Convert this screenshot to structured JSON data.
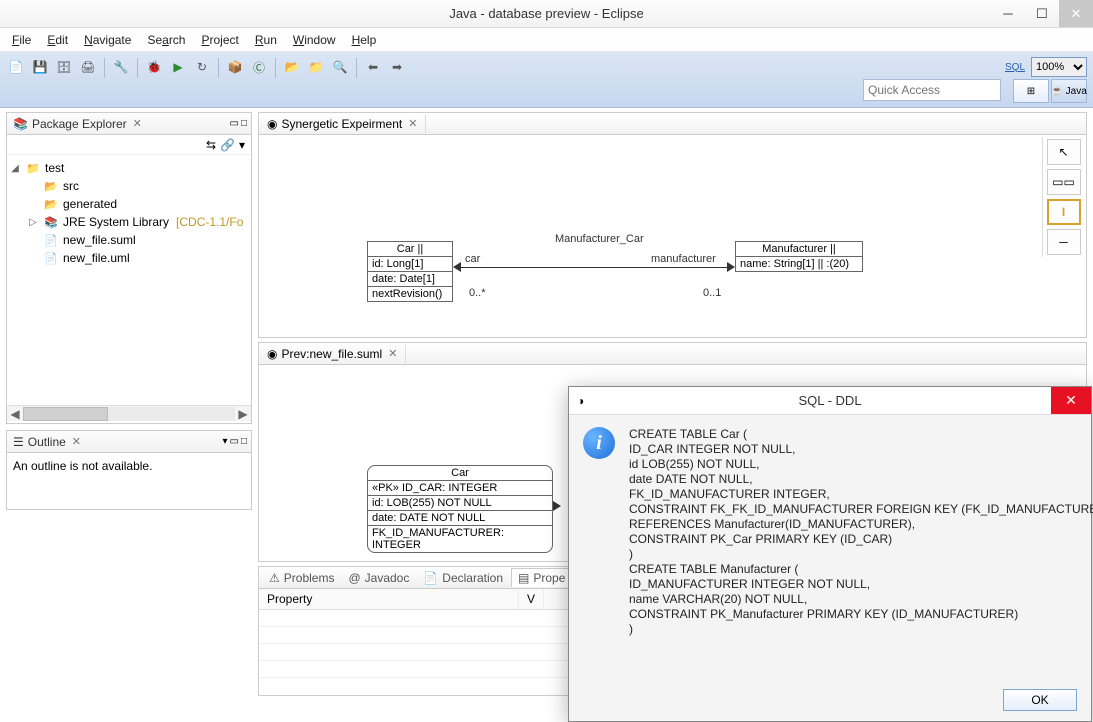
{
  "window": {
    "title": "Java - database preview - Eclipse"
  },
  "menu": {
    "file": "File",
    "edit": "Edit",
    "navigate": "Navigate",
    "search": "Search",
    "project": "Project",
    "run": "Run",
    "window": "Window",
    "help": "Help"
  },
  "toolbar": {
    "zoom": "100%",
    "quick_access_placeholder": "Quick Access",
    "perspective_java": "Java"
  },
  "package_explorer": {
    "title": "Package Explorer",
    "nodes": {
      "test": "test",
      "src": "src",
      "generated": "generated",
      "jre": "JRE System Library",
      "jre_suffix": "[CDC-1.1/Fo",
      "suml": "new_file.suml",
      "uml": "new_file.uml"
    }
  },
  "outline": {
    "title": "Outline",
    "empty_text": "An outline is not available."
  },
  "editor1": {
    "tab": "Synergetic Expeirment",
    "assoc_name": "Manufacturer_Car",
    "role_left": "car",
    "role_right": "manufacturer",
    "mult_left": "0..*",
    "mult_right": "0..1",
    "class_car": {
      "name": "Car ||",
      "attr1": "id: Long[1]",
      "attr2": "date: Date[1]",
      "op1": "nextRevision()"
    },
    "class_manu": {
      "name": "Manufacturer ||",
      "attr1": "name: String[1] || :(20)"
    }
  },
  "editor2": {
    "tab": "Prev:new_file.suml",
    "class_car": {
      "name": "Car",
      "r1": "«PK» ID_CAR: INTEGER",
      "r2": "id: LOB(255) NOT NULL",
      "r3": "date: DATE NOT NULL",
      "r4": "FK_ID_MANUFACTURER: INTEGER"
    }
  },
  "bottom_tabs": {
    "problems": "Problems",
    "javadoc": "Javadoc",
    "declaration": "Declaration",
    "properties": "Prope"
  },
  "properties": {
    "col_property": "Property",
    "col_value": "V"
  },
  "dialog": {
    "title": "SQL - DDL",
    "ok": "OK",
    "sql": "CREATE TABLE Car (\nID_CAR INTEGER NOT NULL,\nid LOB(255) NOT NULL,\ndate DATE NOT NULL,\nFK_ID_MANUFACTURER INTEGER,\nCONSTRAINT FK_FK_ID_MANUFACTURER FOREIGN KEY (FK_ID_MANUFACTURER)\nREFERENCES Manufacturer(ID_MANUFACTURER),\nCONSTRAINT PK_Car PRIMARY KEY (ID_CAR)\n)\nCREATE TABLE Manufacturer (\nID_MANUFACTURER INTEGER NOT NULL,\nname VARCHAR(20) NOT NULL,\nCONSTRAINT PK_Manufacturer PRIMARY KEY (ID_MANUFACTURER)\n)"
  }
}
